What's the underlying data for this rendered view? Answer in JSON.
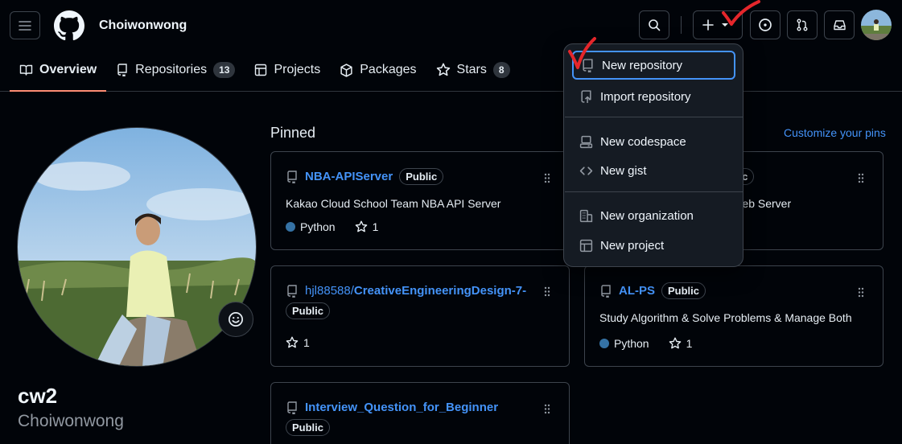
{
  "header": {
    "username": "Choiwonwong",
    "tabs": [
      {
        "label": "Overview",
        "icon": "book-icon"
      },
      {
        "label": "Repositories",
        "count": "13",
        "icon": "repo-icon"
      },
      {
        "label": "Projects",
        "icon": "table-icon"
      },
      {
        "label": "Packages",
        "icon": "package-icon"
      },
      {
        "label": "Stars",
        "count": "8",
        "icon": "star-icon"
      }
    ]
  },
  "profile": {
    "name": "cw2",
    "login": "Choiwonwong"
  },
  "pinned": {
    "title": "Pinned",
    "customize": "Customize your pins",
    "cards": [
      {
        "name": "NBA-APIServer",
        "badge": "Public",
        "desc": "Kakao Cloud School Team NBA API Server",
        "lang": "Python",
        "stars": "1"
      },
      {
        "name": "",
        "badge": "Public",
        "desc": "A Web Server",
        "lang": "",
        "stars": ""
      },
      {
        "owner": "hjl88588/",
        "name": "CreativeEngineeringDesign-7-",
        "badge": "Public",
        "desc": "",
        "lang": "",
        "stars": "1"
      },
      {
        "name": "AL-PS",
        "badge": "Public",
        "desc": "Study Algorithm & Solve Problems & Manage Both",
        "lang": "Python",
        "stars": "1"
      },
      {
        "name": "Interview_Question_for_Beginner",
        "badge": "Public",
        "desc": "",
        "lang": "",
        "stars": ""
      }
    ],
    "card2_badge_fragment": "blic"
  },
  "menu": {
    "items": [
      {
        "label": "New repository",
        "icon": "repo-icon"
      },
      {
        "label": "Import repository",
        "icon": "repo-push-icon"
      },
      {
        "label": "New codespace",
        "icon": "codespaces-icon"
      },
      {
        "label": "New gist",
        "icon": "code-icon"
      },
      {
        "label": "New organization",
        "icon": "organization-icon"
      },
      {
        "label": "New project",
        "icon": "table-icon"
      }
    ]
  },
  "colors": {
    "accent": "#4493f8",
    "annotation": "#e5262b",
    "tab_underline": "#fd8c73",
    "python": "#3572a5"
  }
}
